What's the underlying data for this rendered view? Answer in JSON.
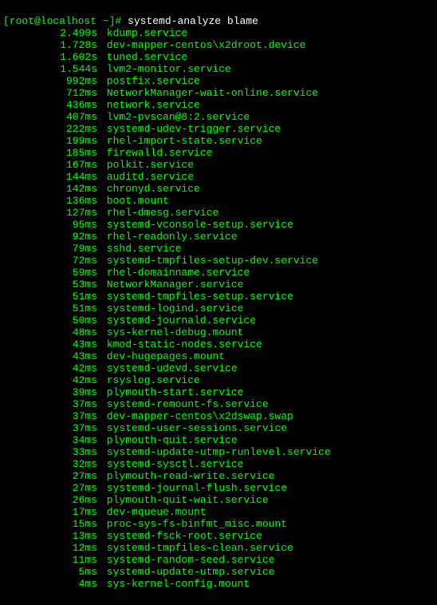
{
  "prompt": {
    "user_host": "[root@localhost ~]#",
    "command": "systemd-analyze blame"
  },
  "entries": [
    {
      "time": "2.490s",
      "service": "kdump.service"
    },
    {
      "time": "1.728s",
      "service": "dev-mapper-centos\\x2droot.device"
    },
    {
      "time": "1.602s",
      "service": "tuned.service"
    },
    {
      "time": "1.544s",
      "service": "lvm2-monitor.service"
    },
    {
      "time": "992ms",
      "service": "postfix.service"
    },
    {
      "time": "712ms",
      "service": "NetworkManager-wait-online.service"
    },
    {
      "time": "436ms",
      "service": "network.service"
    },
    {
      "time": "407ms",
      "service": "lvm2-pvscan@8:2.service"
    },
    {
      "time": "222ms",
      "service": "systemd-udev-trigger.service"
    },
    {
      "time": "199ms",
      "service": "rhel-import-state.service"
    },
    {
      "time": "185ms",
      "service": "firewalld.service"
    },
    {
      "time": "167ms",
      "service": "polkit.service"
    },
    {
      "time": "144ms",
      "service": "auditd.service"
    },
    {
      "time": "142ms",
      "service": "chronyd.service"
    },
    {
      "time": "136ms",
      "service": "boot.mount"
    },
    {
      "time": "127ms",
      "service": "rhel-dmesg.service"
    },
    {
      "time": "95ms",
      "service": "systemd-vconsole-setup.service"
    },
    {
      "time": "92ms",
      "service": "rhel-readonly.service"
    },
    {
      "time": "79ms",
      "service": "sshd.service"
    },
    {
      "time": "72ms",
      "service": "systemd-tmpfiles-setup-dev.service"
    },
    {
      "time": "59ms",
      "service": "rhel-domainname.service"
    },
    {
      "time": "53ms",
      "service": "NetworkManager.service"
    },
    {
      "time": "51ms",
      "service": "systemd-tmpfiles-setup.service"
    },
    {
      "time": "51ms",
      "service": "systemd-logind.service"
    },
    {
      "time": "50ms",
      "service": "systemd-journald.service"
    },
    {
      "time": "48ms",
      "service": "sys-kernel-debug.mount"
    },
    {
      "time": "43ms",
      "service": "kmod-static-nodes.service"
    },
    {
      "time": "43ms",
      "service": "dev-hugepages.mount"
    },
    {
      "time": "42ms",
      "service": "systemd-udevd.service"
    },
    {
      "time": "42ms",
      "service": "rsyslog.service"
    },
    {
      "time": "39ms",
      "service": "plymouth-start.service"
    },
    {
      "time": "37ms",
      "service": "systemd-remount-fs.service"
    },
    {
      "time": "37ms",
      "service": "dev-mapper-centos\\x2dswap.swap"
    },
    {
      "time": "37ms",
      "service": "systemd-user-sessions.service"
    },
    {
      "time": "34ms",
      "service": "plymouth-quit.service"
    },
    {
      "time": "33ms",
      "service": "systemd-update-utmp-runlevel.service"
    },
    {
      "time": "32ms",
      "service": "systemd-sysctl.service"
    },
    {
      "time": "27ms",
      "service": "plymouth-read-write.service"
    },
    {
      "time": "27ms",
      "service": "systemd-journal-flush.service"
    },
    {
      "time": "26ms",
      "service": "plymouth-quit-wait.service"
    },
    {
      "time": "17ms",
      "service": "dev-mqueue.mount"
    },
    {
      "time": "15ms",
      "service": "proc-sys-fs-binfmt_misc.mount"
    },
    {
      "time": "13ms",
      "service": "systemd-fsck-root.service"
    },
    {
      "time": "12ms",
      "service": "systemd-tmpfiles-clean.service"
    },
    {
      "time": "11ms",
      "service": "systemd-random-seed.service"
    },
    {
      "time": "5ms",
      "service": "systemd-update-utmp.service"
    },
    {
      "time": "4ms",
      "service": "sys-kernel-config.mount"
    }
  ]
}
